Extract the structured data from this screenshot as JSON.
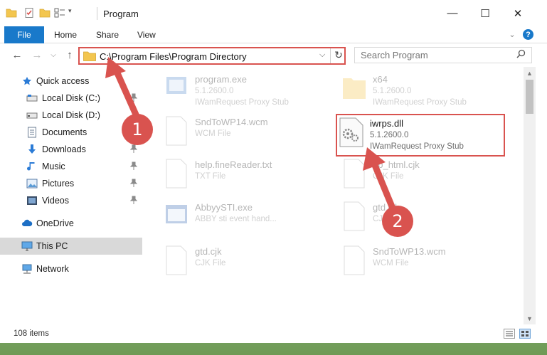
{
  "window": {
    "title": "Program",
    "minimize_glyph": "—",
    "maximize_glyph": "☐",
    "close_glyph": "✕"
  },
  "ribbon": {
    "file": "File",
    "tabs": [
      "Home",
      "Share",
      "View"
    ],
    "help_glyph": "?"
  },
  "address_bar": {
    "path": "C:\\Program Files\\Program Directory",
    "dropdown_glyph": "⌵",
    "refresh_glyph": "↻"
  },
  "search": {
    "placeholder": "Search Program",
    "glyph": "⚲"
  },
  "nav": {
    "back": "←",
    "forward": "→",
    "recent": "⌵",
    "up": "↑"
  },
  "sidebar": {
    "items": [
      {
        "label": "Quick access",
        "icon": "star-icon",
        "pinned": false
      },
      {
        "label": "Local Disk (C:)",
        "icon": "drive-icon",
        "pinned": true
      },
      {
        "label": "Local Disk (D:)",
        "icon": "drive-icon",
        "pinned": false
      },
      {
        "label": "Documents",
        "icon": "documents-icon",
        "pinned": true
      },
      {
        "label": "Downloads",
        "icon": "download-icon",
        "pinned": true
      },
      {
        "label": "Music",
        "icon": "music-icon",
        "pinned": true
      },
      {
        "label": "Pictures",
        "icon": "pictures-icon",
        "pinned": true
      },
      {
        "label": "Videos",
        "icon": "videos-icon",
        "pinned": true
      },
      {
        "label": "OneDrive",
        "icon": "cloud-icon",
        "pinned": false
      },
      {
        "label": "This PC",
        "icon": "monitor-icon",
        "pinned": false,
        "selected": true
      },
      {
        "label": "Network",
        "icon": "network-icon",
        "pinned": false
      }
    ],
    "pin_glyph": "📌"
  },
  "files": [
    {
      "name": "program.exe",
      "sub1": "5.1.2600.0",
      "sub2": "IWamRequest Proxy Stub",
      "icon": "exe-icon"
    },
    {
      "name": "x64",
      "sub1": "5.1.2600.0",
      "sub2": "IWamRequest Proxy Stub",
      "icon": "folder-icon"
    },
    {
      "name": "SndToWP14.wcm",
      "sub1": "WCM File",
      "sub2": "",
      "icon": "file-icon"
    },
    {
      "name": "iwrps.dll",
      "sub1": "5.1.2600.0",
      "sub2": "IWamRequest Proxy Stub",
      "icon": "dll-icon",
      "highlight": true
    },
    {
      "name": "help.fineReader.txt",
      "sub1": "TXT File",
      "sub2": "",
      "icon": "file-icon"
    },
    {
      "name": "gb_html.cjk",
      "sub1": "CJK File",
      "sub2": "",
      "icon": "file-icon"
    },
    {
      "name": "AbbyySTI.exe",
      "sub1": "ABBY sti event hand...",
      "sub2": "",
      "icon": "exe-icon"
    },
    {
      "name": "gtd.cjk",
      "sub1": "CJK File",
      "sub2": "",
      "icon": "file-icon"
    },
    {
      "name": "gtd.cjk",
      "sub1": "CJK File",
      "sub2": "",
      "icon": "file-icon"
    },
    {
      "name": "SndToWP13.wcm",
      "sub1": "WCM File",
      "sub2": "",
      "icon": "file-icon"
    }
  ],
  "status": {
    "item_count": "108 items"
  },
  "annotations": {
    "badge1": "1",
    "badge2": "2",
    "color": "#d9534f"
  },
  "colors": {
    "accent": "#1979ca",
    "highlight_red": "#d9534f",
    "selected_bg": "#d9d9d9"
  }
}
